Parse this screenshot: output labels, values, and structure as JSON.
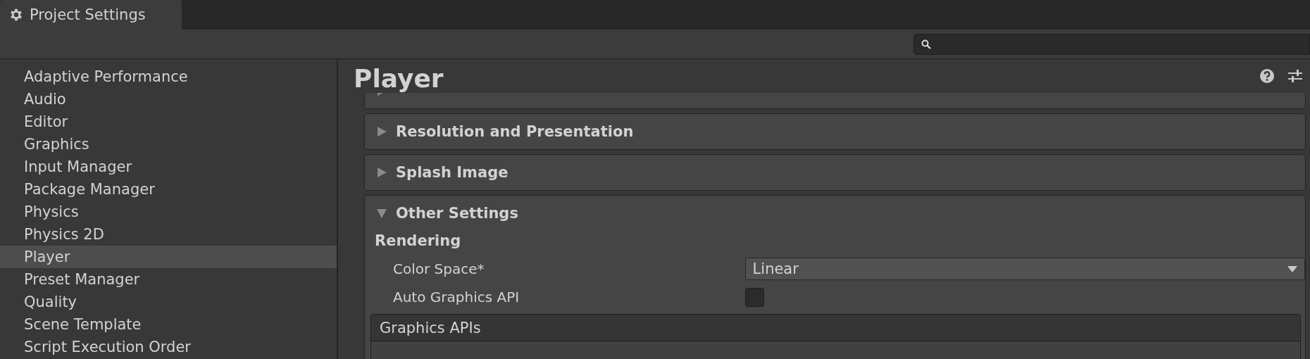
{
  "window": {
    "title": "Project Settings"
  },
  "sidebar": {
    "items": [
      {
        "label": "Adaptive Performance",
        "selected": false
      },
      {
        "label": "Audio",
        "selected": false
      },
      {
        "label": "Editor",
        "selected": false
      },
      {
        "label": "Graphics",
        "selected": false
      },
      {
        "label": "Input Manager",
        "selected": false
      },
      {
        "label": "Package Manager",
        "selected": false
      },
      {
        "label": "Physics",
        "selected": false
      },
      {
        "label": "Physics 2D",
        "selected": false
      },
      {
        "label": "Player",
        "selected": true
      },
      {
        "label": "Preset Manager",
        "selected": false
      },
      {
        "label": "Quality",
        "selected": false
      },
      {
        "label": "Scene Template",
        "selected": false
      },
      {
        "label": "Script Execution Order",
        "selected": false
      }
    ]
  },
  "panel": {
    "title": "Player",
    "sections": [
      {
        "expanded": false
      },
      {
        "label": "Resolution and Presentation",
        "expanded": false
      },
      {
        "label": "Splash Image",
        "expanded": false
      },
      {
        "label": "Other Settings",
        "expanded": true
      }
    ],
    "group": "Rendering",
    "fields": [
      {
        "kind": "dropdown",
        "label": "Color Space*",
        "value": "Linear"
      },
      {
        "kind": "checkbox",
        "label": "Auto Graphics API",
        "checked": false
      }
    ],
    "list": {
      "title": "Graphics APIs"
    }
  }
}
